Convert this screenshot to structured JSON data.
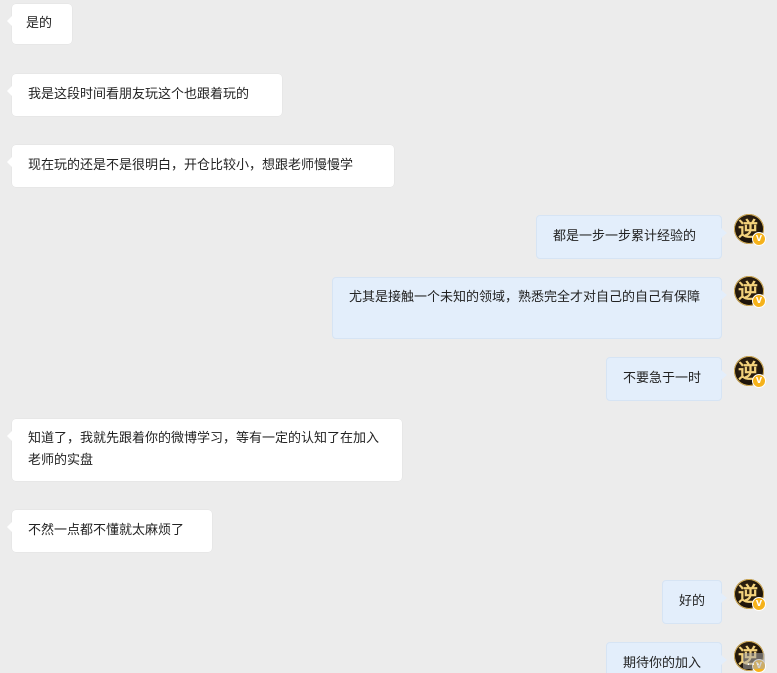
{
  "messages": [
    {
      "side": "in",
      "text": "是的"
    },
    {
      "side": "in",
      "text": "我是这段时间看朋友玩这个也跟着玩的"
    },
    {
      "side": "in",
      "text": "现在玩的还是不是很明白，开仓比较小，想跟老师慢慢学"
    },
    {
      "side": "out",
      "text": "都是一步一步累计经验的"
    },
    {
      "side": "out",
      "text": "尤其是接触一个未知的领域，熟悉完全才对自己的自己有保障"
    },
    {
      "side": "out",
      "text": "不要急于一时"
    },
    {
      "side": "in",
      "text": "知道了，我就先跟着你的微博学习，等有一定的认知了在加入老师的实盘"
    },
    {
      "side": "in",
      "text": "不然一点都不懂就太麻烦了"
    },
    {
      "side": "out",
      "text": "好的"
    },
    {
      "side": "out",
      "text": "期待你的加入"
    }
  ],
  "avatar": {
    "glyph": "逆",
    "badge": "V",
    "badge_color": "#f5b21b"
  },
  "colors": {
    "background": "#ececec",
    "incoming_bubble": "#ffffff",
    "outgoing_bubble": "#e3eefb"
  },
  "watermark": "⁠⁠⁠..."
}
